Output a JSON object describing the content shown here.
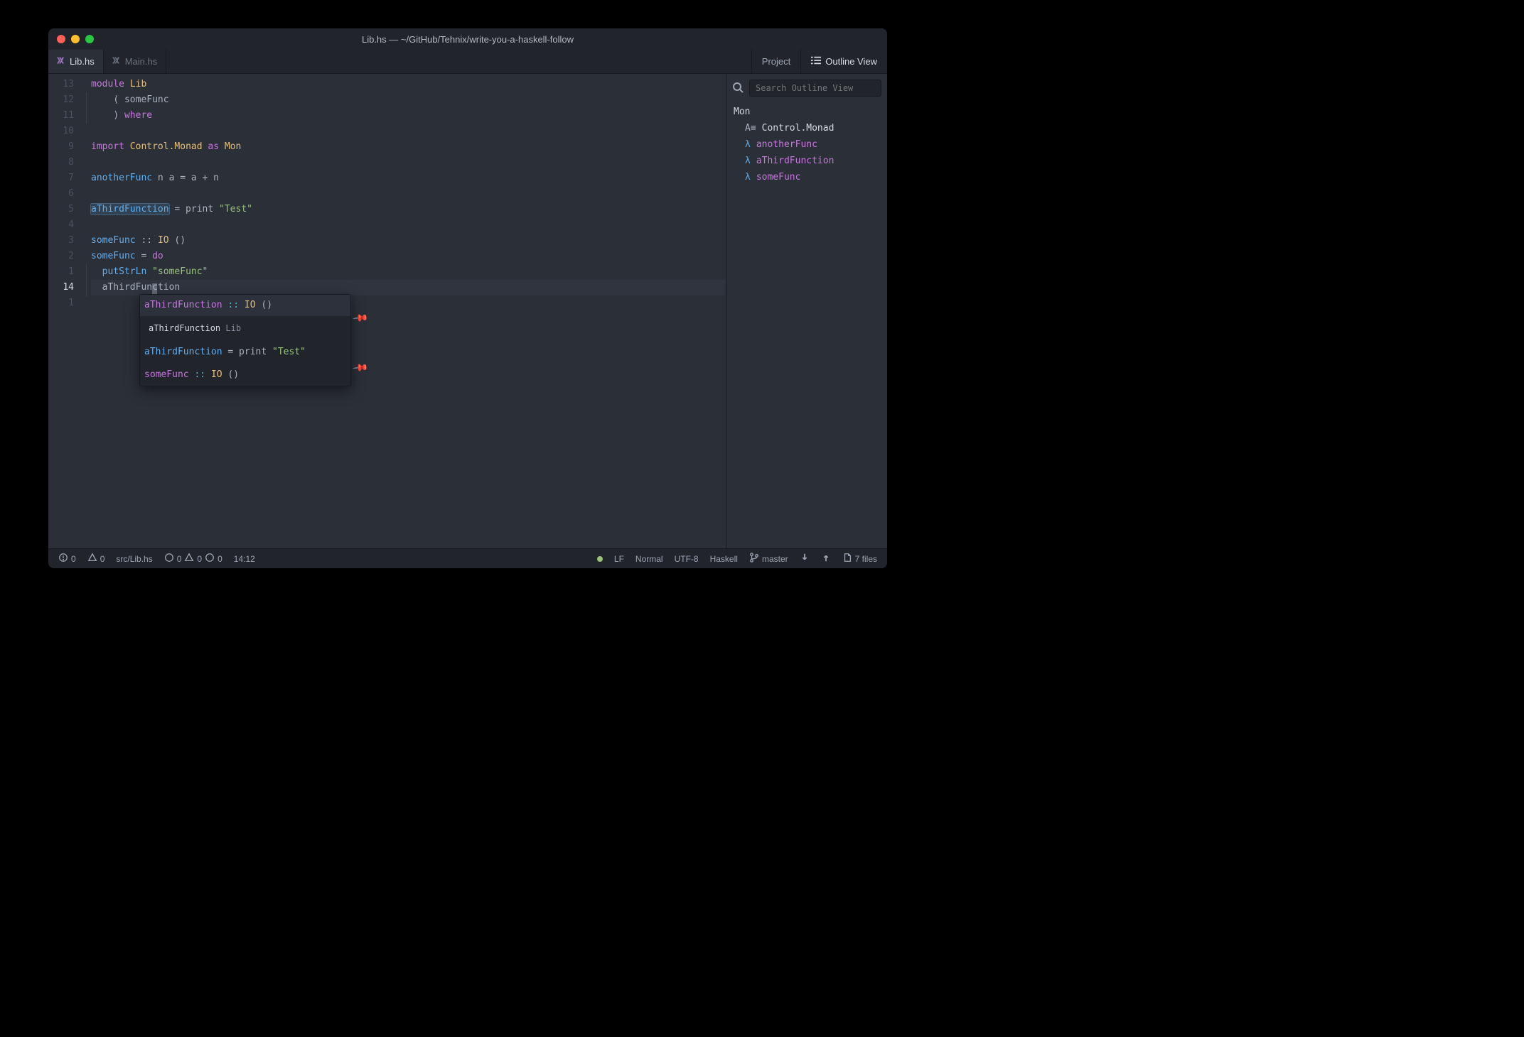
{
  "window": {
    "title": "Lib.hs — ~/GitHub/Tehnix/write-you-a-haskell-follow"
  },
  "tabs": {
    "file1": "Lib.hs",
    "file2": "Main.hs",
    "project": "Project",
    "outline": "Outline View"
  },
  "gutter": [
    "13",
    "12",
    "11",
    "10",
    "9",
    "8",
    "7",
    "6",
    "5",
    "4",
    "3",
    "2",
    "1",
    "14",
    "1"
  ],
  "code": {
    "l1_module": "module",
    "l1_lib": "Lib",
    "l2_open": "( ",
    "l2_some": "someFunc",
    "l3_close": ") ",
    "l3_where": "where",
    "l5_import": "import",
    "l5_cm": "Control.Monad",
    "l5_as": "as",
    "l5_mon": "Mon",
    "l7_af": "anotherFunc",
    "l7_rest": " n a = a + n",
    "l9_atf": "aThirdFunction",
    "l9_rest": " = print ",
    "l9_str": "\"Test\"",
    "l11_sf": "someFunc",
    "l11_dcolon": " :: ",
    "l11_io": "IO",
    "l11_unit": " ()",
    "l12_sf": "someFunc",
    "l12_eq": " = ",
    "l12_do": "do",
    "l13_put": "putStrLn",
    "l13_str": " \"someFunc\"",
    "l14_pre": "aThirdFun",
    "l14_c": "c",
    "l14_post": "tion"
  },
  "autocomplete": {
    "sig1_name": "aThirdFunction",
    "sig1_dcolon": " :: ",
    "sig1_io": "IO",
    "sig1_unit": " ()",
    "sub1_name": "aThirdFunction",
    "sub1_mod": "Lib",
    "body_name": "aThirdFunction",
    "body_rest": " = print ",
    "body_str": "\"Test\"",
    "sig2_name": "someFunc",
    "sig2_dcolon": " :: ",
    "sig2_io": "IO",
    "sig2_unit": " ()"
  },
  "outline": {
    "search_placeholder": "Search Outline View",
    "heading": "Mon",
    "mod": "Control.Monad",
    "f1": "anotherFunc",
    "f2": "aThirdFunction",
    "f3": "someFunc"
  },
  "status": {
    "err": "0",
    "warn": "0",
    "path": "src/Lib.hs",
    "diag1": "0",
    "diag2": "0",
    "diag3": "0",
    "pos": "14:12",
    "eol": "LF",
    "mode": "Normal",
    "enc": "UTF-8",
    "lang": "Haskell",
    "branch": "master",
    "files": "7 files"
  }
}
